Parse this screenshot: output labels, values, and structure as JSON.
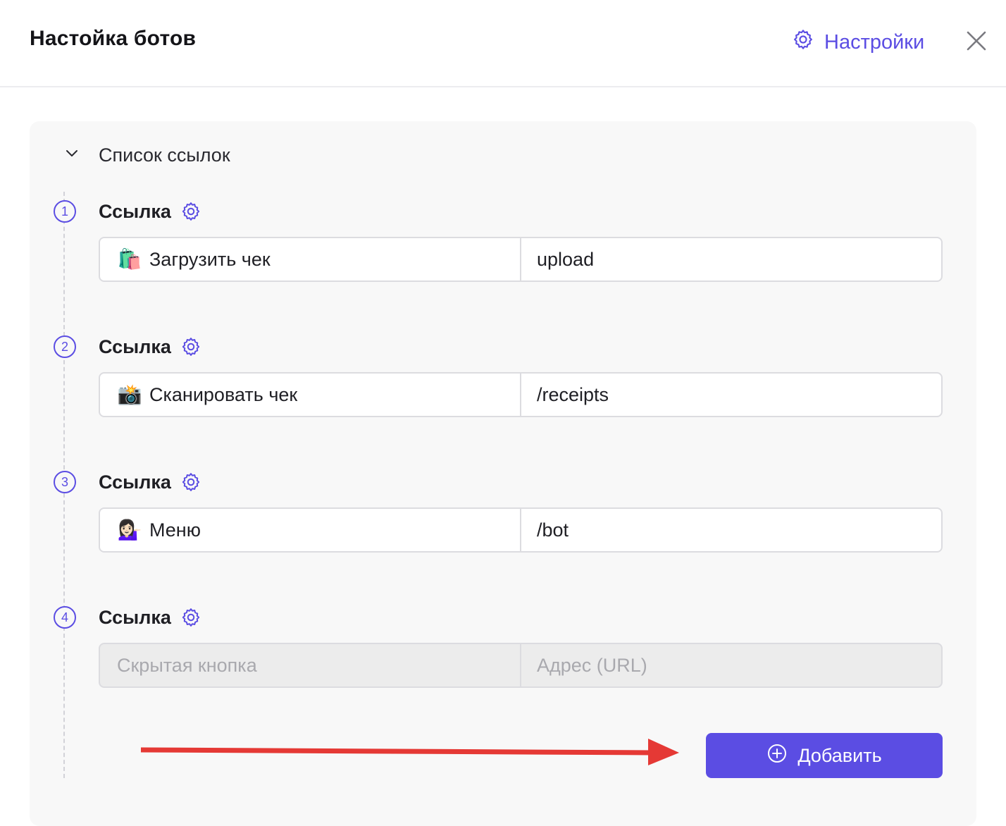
{
  "header": {
    "title": "Настойка ботов",
    "settings_label": "Настройки"
  },
  "section": {
    "title": "Список ссылок",
    "expanded": true
  },
  "links": [
    {
      "number": "1",
      "label": "Ссылка",
      "icon": "shopping-bags-emoji",
      "name": "Загрузить чек",
      "url": "upload"
    },
    {
      "number": "2",
      "label": "Ссылка",
      "icon": "camera-flash-emoji",
      "name": "Сканировать чек",
      "url": "/receipts"
    },
    {
      "number": "3",
      "label": "Ссылка",
      "icon": "tipping-hand-person-emoji",
      "name": "Меню",
      "url": "/bot"
    },
    {
      "number": "4",
      "label": "Ссылка",
      "name_placeholder": "Скрытая кнопка",
      "url_placeholder": "Адрес (URL)"
    }
  ],
  "add_button": {
    "label": "Добавить"
  },
  "colors": {
    "accent": "#5b4de3",
    "annotation_arrow": "#e53935"
  }
}
